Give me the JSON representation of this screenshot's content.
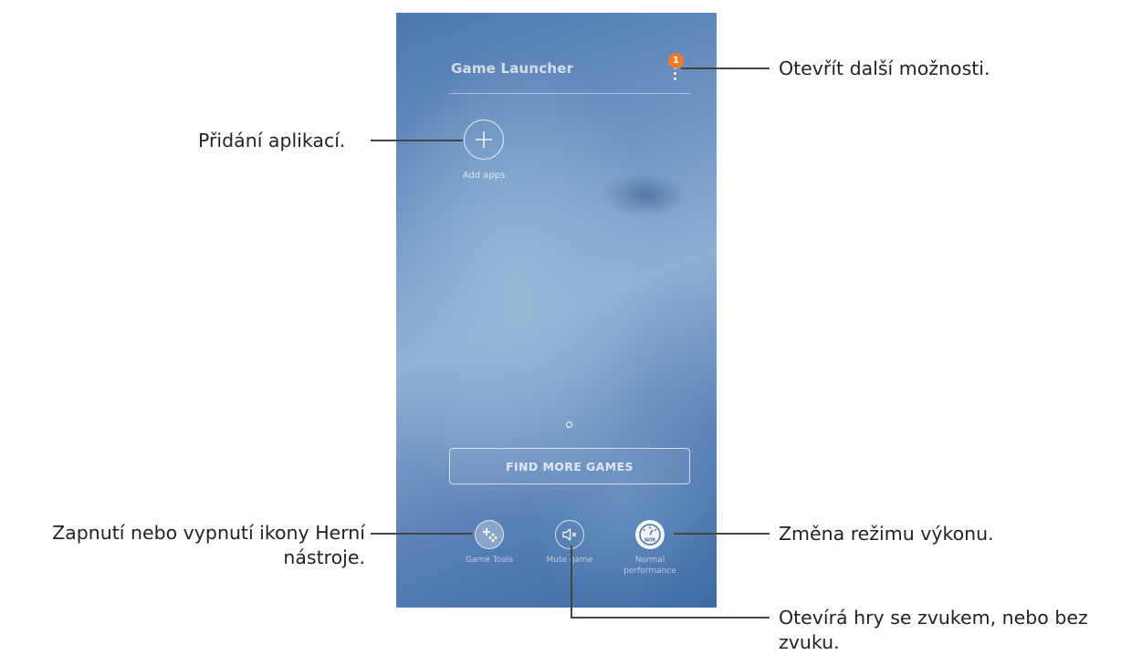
{
  "phone": {
    "app_title": "Game Launcher",
    "notification_count": "1",
    "add_apps_label": "Add apps",
    "find_more_games": "FIND MORE GAMES",
    "tools": [
      {
        "label": "Game Tools",
        "icon": "game-tools-icon"
      },
      {
        "label": "Mute game",
        "icon": "mute-speaker-icon"
      },
      {
        "label_line1": "Normal",
        "label_line2": "performance",
        "icon": "performance-gauge-icon",
        "gauge_text": "NOR"
      }
    ]
  },
  "callouts": {
    "more_options": "Otevřít další možnosti.",
    "add_apps": "Přidání aplikací.",
    "game_tools_line1": "Zapnutí nebo vypnutí ikony Herní",
    "game_tools_line2": "nástroje.",
    "performance": "Změna režimu výkonu.",
    "mute_line1": "Otevírá hry se zvukem, nebo bez",
    "mute_line2": "zvuku."
  },
  "colors": {
    "badge": "#f07a2a",
    "callout_text": "#222222",
    "leader_line": "#444444"
  }
}
